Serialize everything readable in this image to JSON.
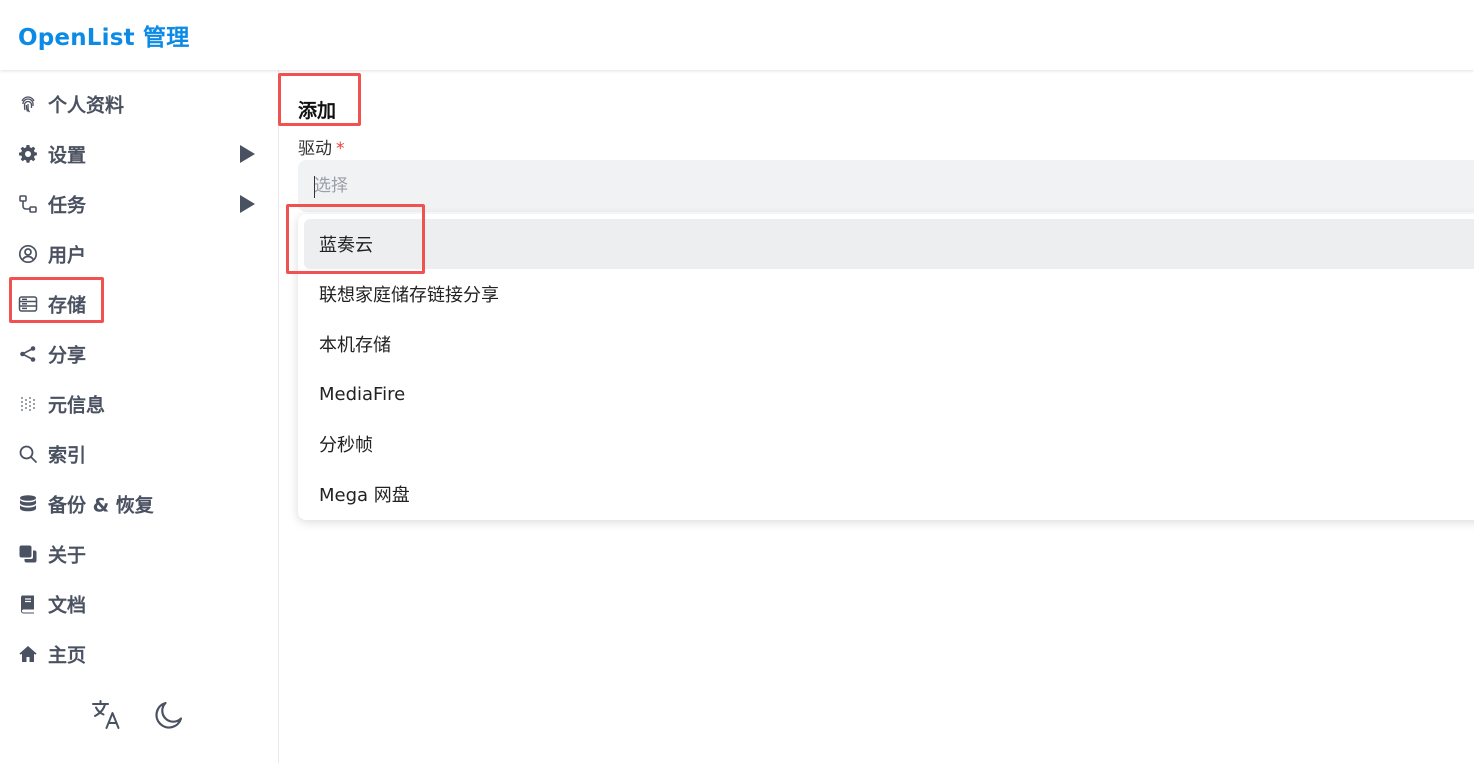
{
  "header": {
    "brand": "OpenList 管理"
  },
  "sidebar": {
    "items": [
      {
        "label": "个人资料",
        "icon": "fingerprint-icon",
        "has_submenu": false
      },
      {
        "label": "设置",
        "icon": "gear-icon",
        "has_submenu": true
      },
      {
        "label": "任务",
        "icon": "workflow-icon",
        "has_submenu": true
      },
      {
        "label": "用户",
        "icon": "user-circle-icon",
        "has_submenu": false
      },
      {
        "label": "存储",
        "icon": "storage-icon",
        "has_submenu": false
      },
      {
        "label": "分享",
        "icon": "share-icon",
        "has_submenu": false
      },
      {
        "label": "元信息",
        "icon": "metadata-icon",
        "has_submenu": false
      },
      {
        "label": "索引",
        "icon": "search-icon",
        "has_submenu": false
      },
      {
        "label": "备份 & 恢复",
        "icon": "database-icon",
        "has_submenu": false
      },
      {
        "label": "关于",
        "icon": "copy-icon",
        "has_submenu": false
      },
      {
        "label": "文档",
        "icon": "book-icon",
        "has_submenu": false
      },
      {
        "label": "主页",
        "icon": "home-icon",
        "has_submenu": false
      }
    ],
    "bottom": {
      "language_icon": "translate-icon",
      "theme_icon": "moon-icon"
    }
  },
  "main": {
    "title": "添加",
    "driver_field": {
      "label": "驱动",
      "required_mark": "*",
      "placeholder": "选择",
      "value": ""
    },
    "options": [
      "蓝奏云",
      "联想家庭储存链接分享",
      "本机存储",
      "MediaFire",
      "分秒帧",
      "Mega 网盘"
    ],
    "active_option_index": 0
  },
  "colors": {
    "brand": "#0b8be6",
    "highlight": "#f05252",
    "nav_text": "#4a5160",
    "required": "#e53e3e",
    "select_bg": "#f1f2f4",
    "option_active_bg": "#edeef0"
  }
}
